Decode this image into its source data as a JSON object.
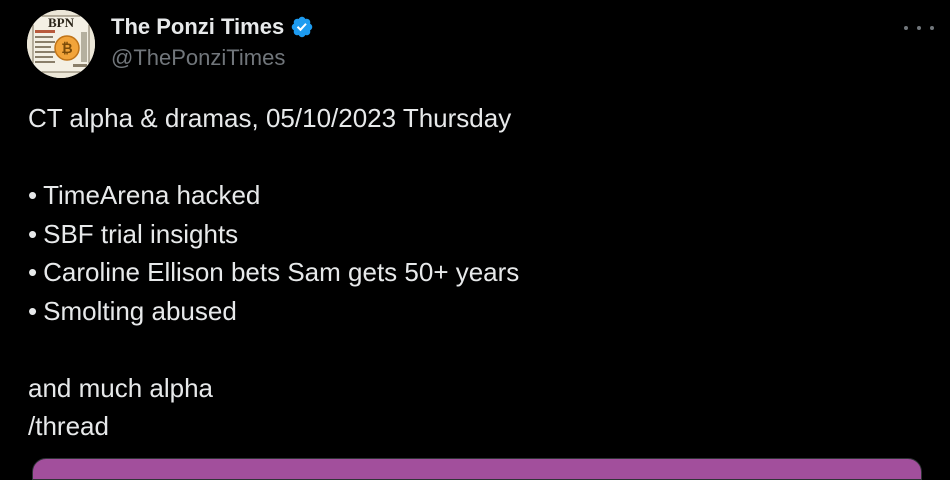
{
  "author": {
    "display_name": "The Ponzi Times",
    "handle": "@ThePonziTimes",
    "verified": true,
    "avatar_icon": "newspaper-logo-icon",
    "avatar_text": "BPN"
  },
  "tweet": {
    "heading": "CT alpha & dramas, 05/10/2023 Thursday",
    "bullets": [
      "TimeArena hacked",
      "SBF trial insights",
      "Caroline Ellison bets Sam gets 50+ years",
      "Smolting abused"
    ],
    "bullet_glyph": "•",
    "closing_lines": [
      "and much alpha",
      "/thread"
    ]
  },
  "icons": {
    "more": "more-options-icon",
    "verified": "verified-badge-icon"
  },
  "colors": {
    "background": "#000000",
    "text_primary": "#e7e9ea",
    "text_secondary": "#71767b",
    "verified_blue": "#1d9bf0"
  }
}
